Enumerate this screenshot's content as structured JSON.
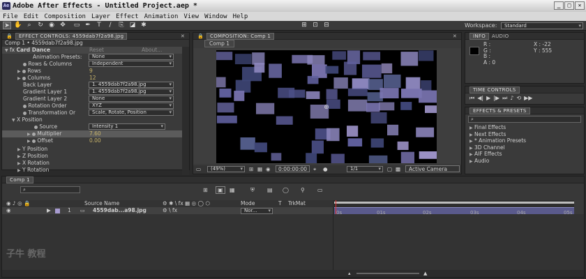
{
  "window": {
    "title": "Adobe After Effects - Untitled Project.aep *",
    "icon_label": "Ae"
  },
  "menu": [
    "File",
    "Edit",
    "Composition",
    "Layer",
    "Effect",
    "Animation",
    "View",
    "Window",
    "Help"
  ],
  "toolbar": {
    "workspace_label": "Workspace:",
    "workspace_value": "Standard"
  },
  "effect_controls": {
    "tab_label": "EFFECT CONTROLS: 4559dab7f2a98.jpg",
    "breadcrumb": "Comp 1 • 4559dab7f2a98.jpg",
    "effect_name": "Card Dance",
    "reset_label": "Reset",
    "about_label": "About...",
    "rows": [
      {
        "label": "Animation Presets:",
        "value": "None"
      },
      {
        "label": "Rows & Columns",
        "value": "Independent"
      },
      {
        "label": "Rows",
        "value": "9"
      },
      {
        "label": "Columns",
        "value": "12"
      },
      {
        "label": "Back Layer",
        "value": "1. 4559dab7f2a98.jpg"
      },
      {
        "label": "Gradient Layer 1",
        "value": "1. 4559dab7f2a98.jpg"
      },
      {
        "label": "Gradient Layer 2",
        "value": "None"
      },
      {
        "label": "Rotation Order",
        "value": "XYZ"
      },
      {
        "label": "Transformation Or",
        "value": "Scale, Rotate, Position"
      },
      {
        "label": "X Position",
        "value": ""
      },
      {
        "label": "Source",
        "value": "Intensity 1"
      },
      {
        "label": "Multiplier",
        "value": "7.60"
      },
      {
        "label": "Offset",
        "value": "0.00"
      },
      {
        "label": "Y Position",
        "value": ""
      },
      {
        "label": "Z Position",
        "value": ""
      },
      {
        "label": "X Rotation",
        "value": ""
      },
      {
        "label": "Y Rotation",
        "value": ""
      }
    ]
  },
  "composition": {
    "tab_label": "COMPOSITION: Comp 1",
    "subtab": "Comp 1",
    "zoom": "(49%)",
    "timecode": "0:00:00:00",
    "resolution": "1/1",
    "camera": "Active Camera"
  },
  "info": {
    "tab_info": "INFO",
    "tab_audio": "AUDIO",
    "r": "R :",
    "g": "G :",
    "b": "B :",
    "a": "A : 0",
    "x": "X : -22",
    "y": "Y : 555"
  },
  "time_controls": {
    "tab_label": "TIME CONTROLS"
  },
  "effects_presets": {
    "tab_label": "EFFECTS & PRESETS",
    "search_placeholder": "",
    "items": [
      "Final Effects",
      "Next Effects",
      "* Animation Presets",
      "3D Channel",
      "AIF Effects",
      "Audio"
    ]
  },
  "timeline": {
    "tab_label": "Comp 1",
    "search_placeholder": "",
    "columns": {
      "source_name": "Source Name",
      "mode": "Mode",
      "t": "T",
      "trkmat": "TrkMat"
    },
    "layer": {
      "number": "1",
      "name": "4559dab...a98.jpg",
      "mode": "Nor..."
    },
    "ticks": [
      "0s",
      "01s",
      "02s",
      "03s",
      "04s",
      "05s"
    ]
  },
  "watermark": {
    "text": "子牛 教程"
  },
  "colors": {
    "accent": "#c8b46a",
    "panel": "#3a3a3a",
    "timeline_bar": "#5a5a8c"
  }
}
